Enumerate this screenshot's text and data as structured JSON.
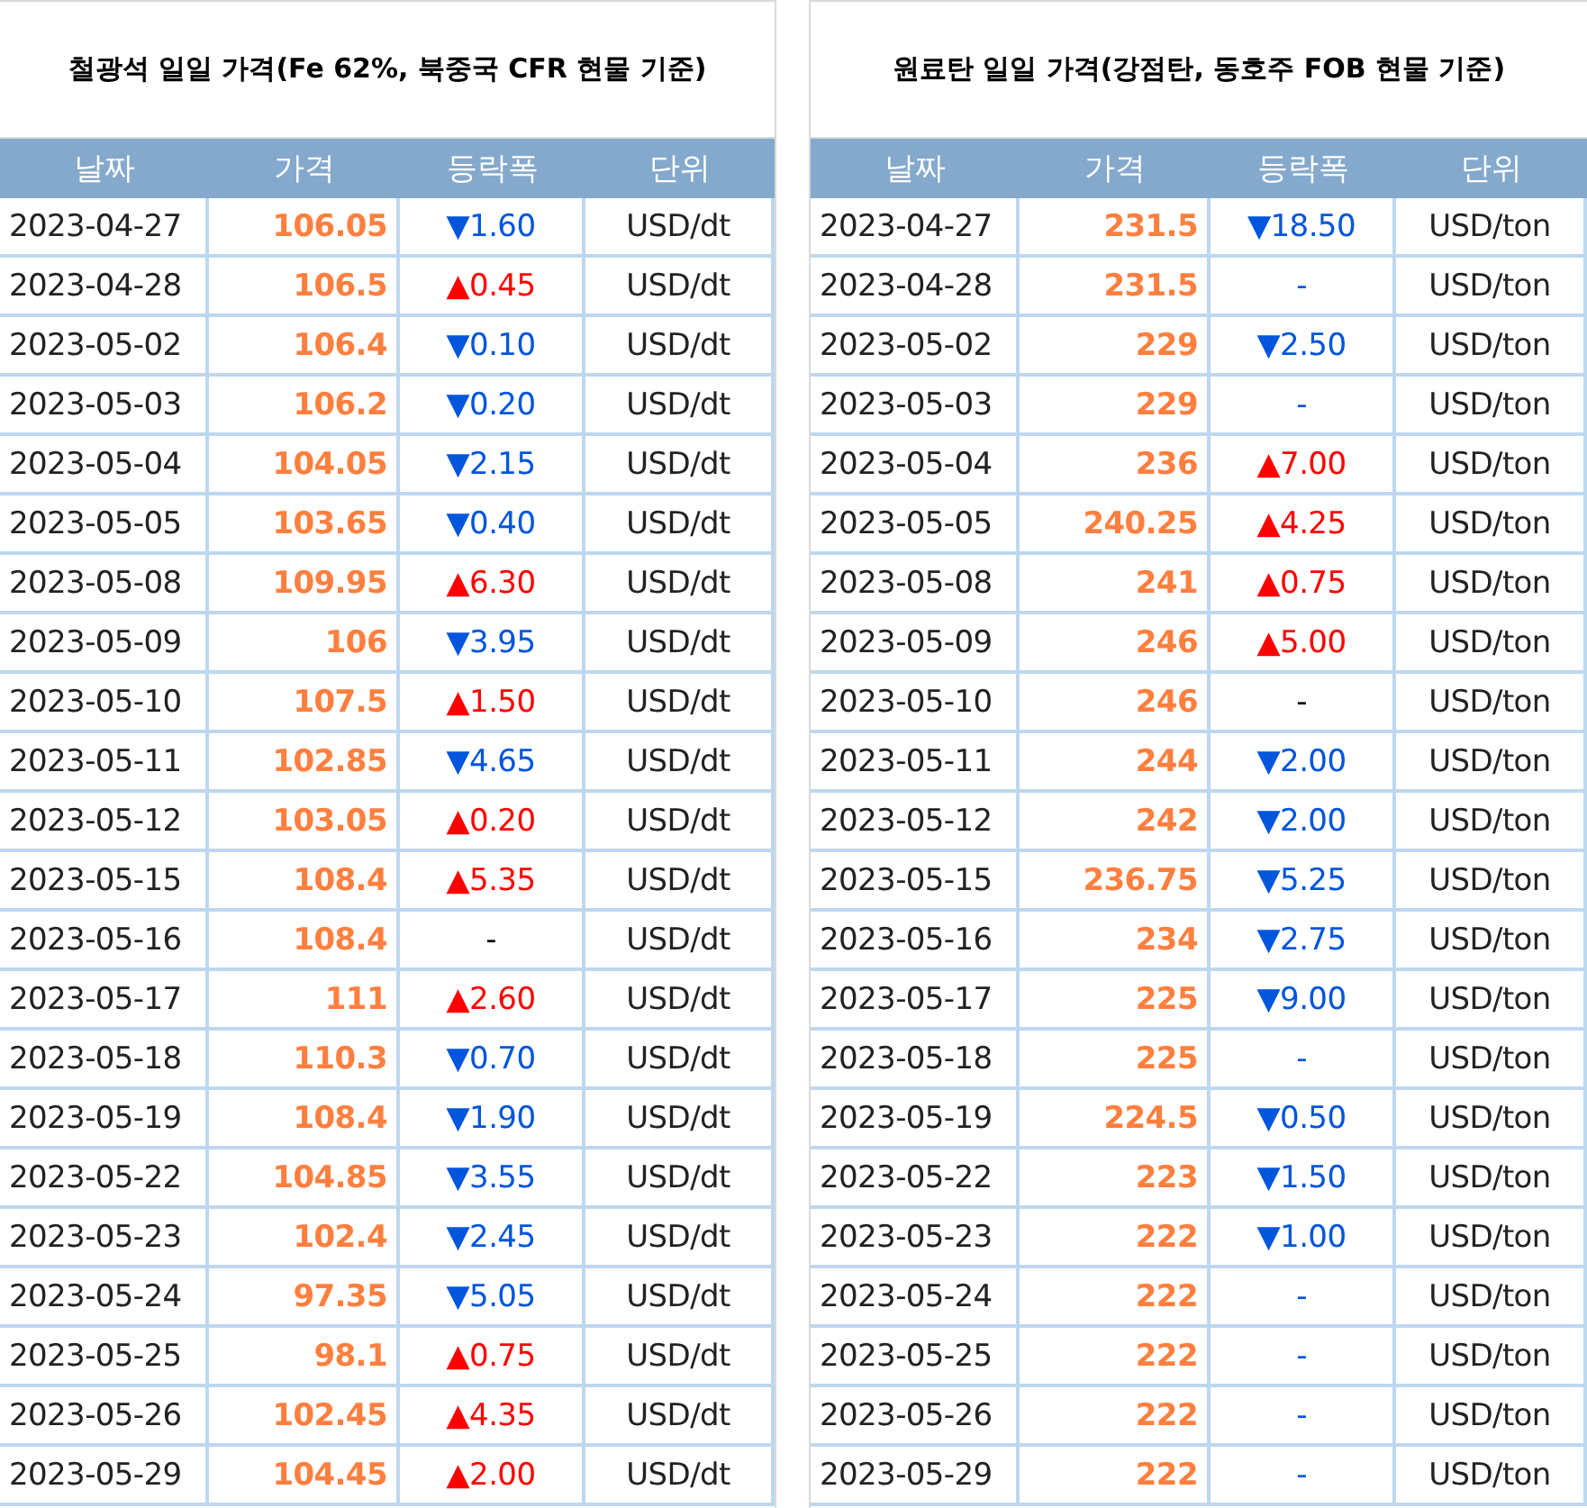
{
  "tables": [
    {
      "title": "철광석 일일 가격(Fe 62%, 북중국 CFR 현물 기준)",
      "columns": [
        "날짜",
        "가격",
        "등락폭",
        "단위"
      ],
      "rows": [
        {
          "date": "2023-04-27",
          "price": "106.05",
          "change": "▼1.60",
          "kind": "down",
          "unit": "USD/dt"
        },
        {
          "date": "2023-04-28",
          "price": "106.5",
          "change": "▲0.45",
          "kind": "up",
          "unit": "USD/dt"
        },
        {
          "date": "2023-05-02",
          "price": "106.4",
          "change": "▼0.10",
          "kind": "down",
          "unit": "USD/dt"
        },
        {
          "date": "2023-05-03",
          "price": "106.2",
          "change": "▼0.20",
          "kind": "down",
          "unit": "USD/dt"
        },
        {
          "date": "2023-05-04",
          "price": "104.05",
          "change": "▼2.15",
          "kind": "down",
          "unit": "USD/dt"
        },
        {
          "date": "2023-05-05",
          "price": "103.65",
          "change": "▼0.40",
          "kind": "down",
          "unit": "USD/dt"
        },
        {
          "date": "2023-05-08",
          "price": "109.95",
          "change": "▲6.30",
          "kind": "up",
          "unit": "USD/dt"
        },
        {
          "date": "2023-05-09",
          "price": "106",
          "change": "▼3.95",
          "kind": "down",
          "unit": "USD/dt"
        },
        {
          "date": "2023-05-10",
          "price": "107.5",
          "change": "▲1.50",
          "kind": "up",
          "unit": "USD/dt"
        },
        {
          "date": "2023-05-11",
          "price": "102.85",
          "change": "▼4.65",
          "kind": "down",
          "unit": "USD/dt"
        },
        {
          "date": "2023-05-12",
          "price": "103.05",
          "change": "▲0.20",
          "kind": "up",
          "unit": "USD/dt"
        },
        {
          "date": "2023-05-15",
          "price": "108.4",
          "change": "▲5.35",
          "kind": "up",
          "unit": "USD/dt"
        },
        {
          "date": "2023-05-16",
          "price": "108.4",
          "change": "-",
          "kind": "none",
          "unit": "USD/dt"
        },
        {
          "date": "2023-05-17",
          "price": "111",
          "change": "▲2.60",
          "kind": "up",
          "unit": "USD/dt"
        },
        {
          "date": "2023-05-18",
          "price": "110.3",
          "change": "▼0.70",
          "kind": "down",
          "unit": "USD/dt"
        },
        {
          "date": "2023-05-19",
          "price": "108.4",
          "change": "▼1.90",
          "kind": "down",
          "unit": "USD/dt"
        },
        {
          "date": "2023-05-22",
          "price": "104.85",
          "change": "▼3.55",
          "kind": "down",
          "unit": "USD/dt"
        },
        {
          "date": "2023-05-23",
          "price": "102.4",
          "change": "▼2.45",
          "kind": "down",
          "unit": "USD/dt"
        },
        {
          "date": "2023-05-24",
          "price": "97.35",
          "change": "▼5.05",
          "kind": "down",
          "unit": "USD/dt"
        },
        {
          "date": "2023-05-25",
          "price": "98.1",
          "change": "▲0.75",
          "kind": "up",
          "unit": "USD/dt"
        },
        {
          "date": "2023-05-26",
          "price": "102.45",
          "change": "▲4.35",
          "kind": "up",
          "unit": "USD/dt"
        },
        {
          "date": "2023-05-29",
          "price": "104.45",
          "change": "▲2.00",
          "kind": "up",
          "unit": "USD/dt"
        }
      ]
    },
    {
      "title": "원료탄 일일 가격(강점탄, 동호주 FOB 현물 기준)",
      "columns": [
        "날짜",
        "가격",
        "등락폭",
        "단위"
      ],
      "rows": [
        {
          "date": "2023-04-27",
          "price": "231.5",
          "change": "▼18.50",
          "kind": "down",
          "unit": "USD/ton"
        },
        {
          "date": "2023-04-28",
          "price": "231.5",
          "change": "-",
          "kind": "flat",
          "unit": "USD/ton"
        },
        {
          "date": "2023-05-02",
          "price": "229",
          "change": "▼2.50",
          "kind": "down",
          "unit": "USD/ton"
        },
        {
          "date": "2023-05-03",
          "price": "229",
          "change": "-",
          "kind": "flat",
          "unit": "USD/ton"
        },
        {
          "date": "2023-05-04",
          "price": "236",
          "change": "▲7.00",
          "kind": "up",
          "unit": "USD/ton"
        },
        {
          "date": "2023-05-05",
          "price": "240.25",
          "change": "▲4.25",
          "kind": "up",
          "unit": "USD/ton"
        },
        {
          "date": "2023-05-08",
          "price": "241",
          "change": "▲0.75",
          "kind": "up",
          "unit": "USD/ton"
        },
        {
          "date": "2023-05-09",
          "price": "246",
          "change": "▲5.00",
          "kind": "up",
          "unit": "USD/ton"
        },
        {
          "date": "2023-05-10",
          "price": "246",
          "change": "-",
          "kind": "none",
          "unit": "USD/ton"
        },
        {
          "date": "2023-05-11",
          "price": "244",
          "change": "▼2.00",
          "kind": "down",
          "unit": "USD/ton"
        },
        {
          "date": "2023-05-12",
          "price": "242",
          "change": "▼2.00",
          "kind": "down",
          "unit": "USD/ton"
        },
        {
          "date": "2023-05-15",
          "price": "236.75",
          "change": "▼5.25",
          "kind": "down",
          "unit": "USD/ton"
        },
        {
          "date": "2023-05-16",
          "price": "234",
          "change": "▼2.75",
          "kind": "down",
          "unit": "USD/ton"
        },
        {
          "date": "2023-05-17",
          "price": "225",
          "change": "▼9.00",
          "kind": "down",
          "unit": "USD/ton"
        },
        {
          "date": "2023-05-18",
          "price": "225",
          "change": "-",
          "kind": "flat",
          "unit": "USD/ton"
        },
        {
          "date": "2023-05-19",
          "price": "224.5",
          "change": "▼0.50",
          "kind": "down",
          "unit": "USD/ton"
        },
        {
          "date": "2023-05-22",
          "price": "223",
          "change": "▼1.50",
          "kind": "down",
          "unit": "USD/ton"
        },
        {
          "date": "2023-05-23",
          "price": "222",
          "change": "▼1.00",
          "kind": "down",
          "unit": "USD/ton"
        },
        {
          "date": "2023-05-24",
          "price": "222",
          "change": "-",
          "kind": "flat",
          "unit": "USD/ton"
        },
        {
          "date": "2023-05-25",
          "price": "222",
          "change": "-",
          "kind": "flat",
          "unit": "USD/ton"
        },
        {
          "date": "2023-05-26",
          "price": "222",
          "change": "-",
          "kind": "flat",
          "unit": "USD/ton"
        },
        {
          "date": "2023-05-29",
          "price": "222",
          "change": "-",
          "kind": "flat",
          "unit": "USD/ton"
        }
      ]
    }
  ]
}
